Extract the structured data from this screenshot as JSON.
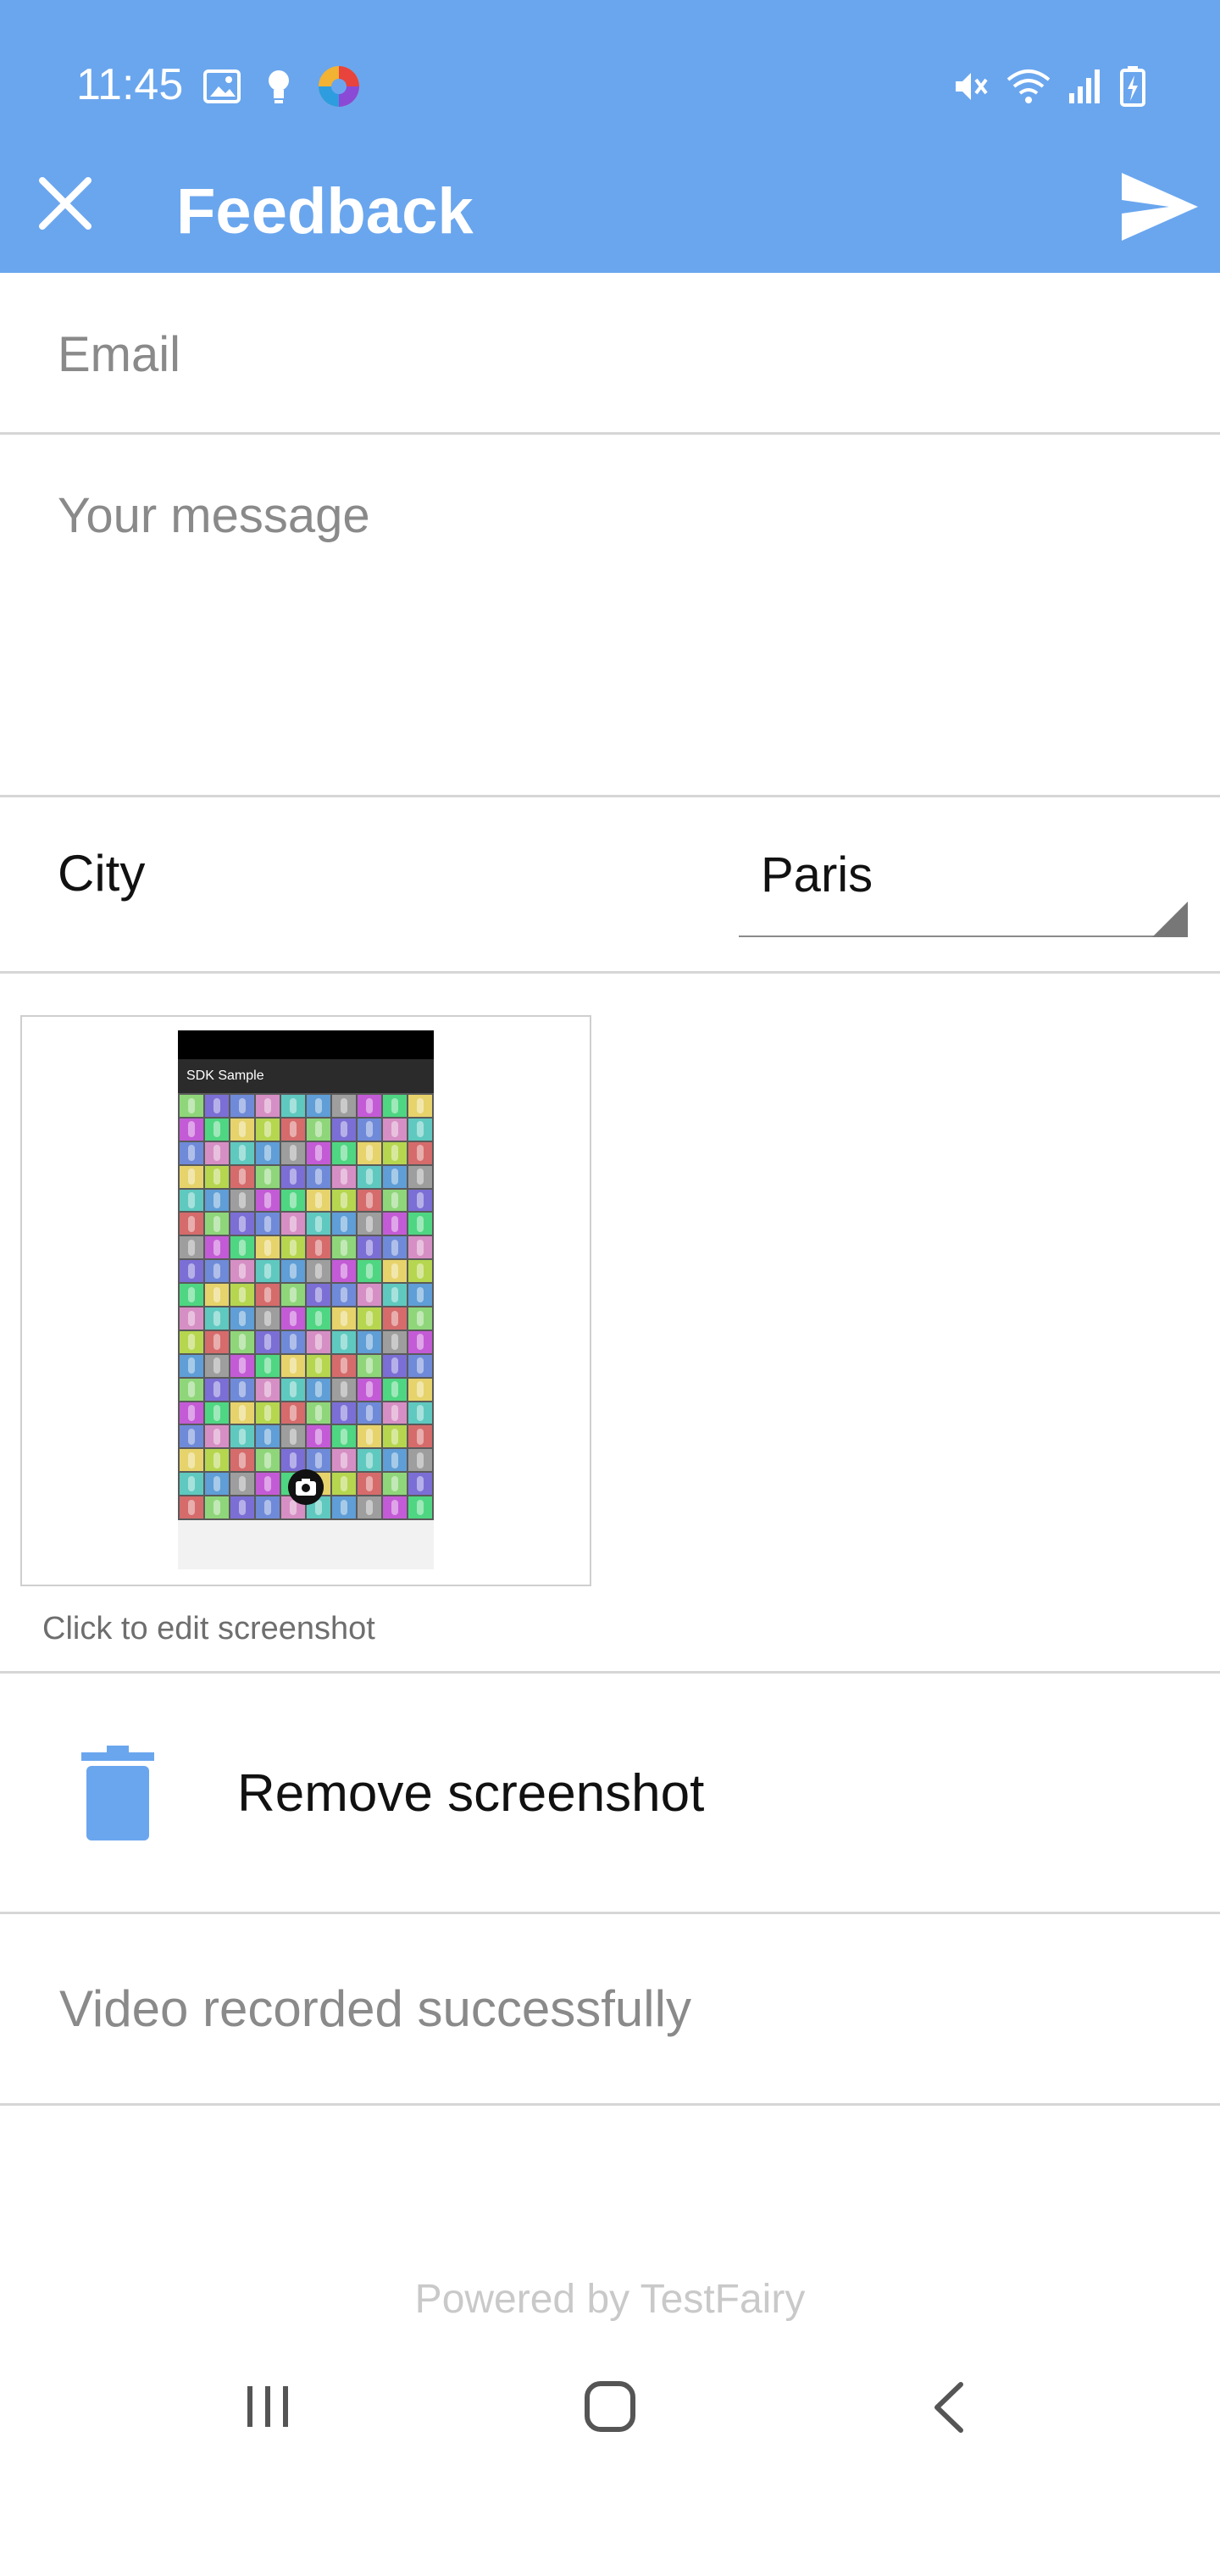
{
  "status_bar": {
    "time": "11:45",
    "left_icons": [
      "image-icon",
      "bulb-icon",
      "app-swirl-icon"
    ],
    "right_icons": [
      "mute-icon",
      "wifi-icon",
      "signal-icon",
      "battery-charging-icon"
    ]
  },
  "app_bar": {
    "title": "Feedback",
    "close_icon": "close-icon",
    "send_icon": "send-icon",
    "background": "#6aa6ee"
  },
  "form": {
    "email_placeholder": "Email",
    "message_placeholder": "Your message",
    "city_label": "City",
    "city_value": "Paris"
  },
  "screenshot": {
    "app_title": "SDK Sample",
    "caption": "Click to edit screenshot"
  },
  "actions": {
    "remove_label": "Remove screenshot",
    "remove_icon": "trash-icon",
    "accent": "#6aa6ee"
  },
  "video_status": "Video recorded successfully",
  "footer": "Powered by TestFairy",
  "nav_bar": {
    "icons": [
      "recent-apps-icon",
      "home-icon",
      "back-icon"
    ]
  }
}
